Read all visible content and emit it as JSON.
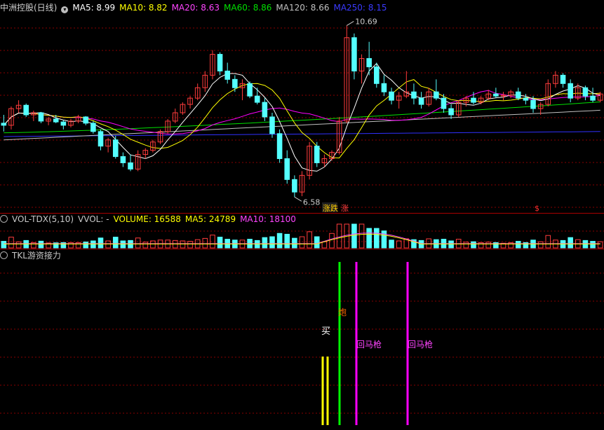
{
  "main_header": {
    "stock_name": "中洲控股(日线)",
    "ma5": "MA5: 8.99",
    "ma10": "MA10: 8.82",
    "ma20": "MA20: 8.63",
    "ma60": "MA60: 8.86",
    "ma120": "MA120: 8.66",
    "ma250": "MA250: 8.15"
  },
  "vol_header": {
    "name": "VOL-TDX(5,10)",
    "vvol": "VVOL: -",
    "volume": "VOLUME: 16588",
    "ma5": "MA5: 24789",
    "ma10": "MA10: 18100"
  },
  "indicator_header": {
    "name": "TKL游资接力"
  },
  "colors": {
    "up": "#ff3c3c",
    "down": "#54ffff",
    "ma5": "#ffffff",
    "ma10": "#ffff00",
    "ma20": "#ff00ff",
    "ma60": "#00e000",
    "ma120": "#c0c0c0",
    "ma250": "#3030ff",
    "grid": "#8a0000",
    "divider": "#aa0000"
  },
  "chart_data": [
    {
      "type": "candlestick",
      "panel": "price",
      "price_range": [
        6.2,
        11.0
      ],
      "annotations": {
        "high_label": "10.69",
        "low_label": "6.58",
        "signal_tags": [
          "涨跌",
          "涨",
          "$"
        ]
      },
      "candles": [
        [
          8.35,
          8.55,
          8.15,
          8.3
        ],
        [
          8.3,
          8.75,
          8.2,
          8.7
        ],
        [
          8.7,
          8.9,
          8.6,
          8.78
        ],
        [
          8.78,
          8.82,
          8.5,
          8.55
        ],
        [
          8.55,
          8.65,
          8.4,
          8.6
        ],
        [
          8.6,
          8.62,
          8.35,
          8.4
        ],
        [
          8.4,
          8.5,
          8.3,
          8.45
        ],
        [
          8.45,
          8.55,
          8.35,
          8.38
        ],
        [
          8.38,
          8.42,
          8.2,
          8.3
        ],
        [
          8.3,
          8.45,
          8.25,
          8.4
        ],
        [
          8.4,
          8.55,
          8.35,
          8.5
        ],
        [
          8.5,
          8.52,
          8.3,
          8.35
        ],
        [
          8.35,
          8.4,
          8.1,
          8.15
        ],
        [
          8.15,
          8.2,
          7.7,
          7.8
        ],
        [
          7.8,
          8.0,
          7.65,
          7.95
        ],
        [
          7.95,
          8.05,
          7.5,
          7.55
        ],
        [
          7.55,
          7.65,
          7.3,
          7.4
        ],
        [
          7.4,
          7.6,
          7.2,
          7.25
        ],
        [
          7.25,
          7.7,
          7.2,
          7.6
        ],
        [
          7.6,
          7.75,
          7.5,
          7.7
        ],
        [
          7.7,
          7.95,
          7.65,
          7.9
        ],
        [
          7.9,
          8.2,
          7.85,
          8.15
        ],
        [
          8.15,
          8.45,
          8.1,
          8.4
        ],
        [
          8.4,
          8.7,
          8.35,
          8.6
        ],
        [
          8.6,
          8.85,
          8.55,
          8.8
        ],
        [
          8.8,
          9.0,
          8.7,
          8.95
        ],
        [
          8.95,
          9.3,
          8.9,
          9.2
        ],
        [
          9.2,
          9.6,
          9.1,
          9.5
        ],
        [
          9.5,
          10.1,
          9.4,
          10.0
        ],
        [
          10.0,
          10.05,
          9.5,
          9.6
        ],
        [
          9.6,
          9.8,
          9.3,
          9.4
        ],
        [
          9.4,
          9.5,
          9.1,
          9.2
        ],
        [
          9.2,
          9.4,
          8.9,
          9.3
        ],
        [
          9.3,
          9.35,
          8.95,
          9.0
        ],
        [
          9.0,
          9.2,
          8.8,
          8.85
        ],
        [
          8.85,
          8.95,
          8.4,
          8.5
        ],
        [
          8.5,
          8.6,
          8.0,
          8.1
        ],
        [
          8.1,
          8.2,
          7.4,
          7.5
        ],
        [
          7.5,
          7.7,
          6.9,
          7.0
        ],
        [
          7.0,
          7.1,
          6.58,
          6.7
        ],
        [
          6.7,
          7.2,
          6.6,
          7.1
        ],
        [
          7.1,
          7.9,
          7.0,
          7.8
        ],
        [
          7.8,
          7.9,
          7.3,
          7.4
        ],
        [
          7.4,
          7.6,
          7.3,
          7.5
        ],
        [
          7.5,
          7.7,
          7.45,
          7.65
        ],
        [
          7.65,
          8.5,
          7.6,
          8.4
        ],
        [
          8.4,
          10.69,
          8.35,
          10.4
        ],
        [
          10.4,
          10.5,
          9.4,
          9.6
        ],
        [
          9.6,
          10.0,
          9.3,
          9.9
        ],
        [
          9.9,
          10.3,
          9.5,
          9.7
        ],
        [
          9.7,
          9.8,
          9.2,
          9.3
        ],
        [
          9.3,
          9.5,
          9.0,
          9.1
        ],
        [
          9.1,
          9.2,
          8.8,
          8.9
        ],
        [
          8.9,
          9.1,
          8.7,
          9.0
        ],
        [
          9.0,
          9.6,
          8.95,
          9.1
        ],
        [
          9.1,
          9.3,
          8.8,
          8.95
        ],
        [
          8.95,
          9.1,
          8.7,
          8.8
        ],
        [
          8.8,
          9.2,
          8.75,
          9.1
        ],
        [
          9.1,
          9.4,
          8.9,
          8.95
        ],
        [
          8.95,
          9.05,
          8.6,
          8.7
        ],
        [
          8.7,
          8.8,
          8.45,
          8.55
        ],
        [
          8.55,
          8.9,
          8.5,
          8.85
        ],
        [
          8.85,
          9.0,
          8.75,
          8.95
        ],
        [
          8.95,
          9.1,
          8.8,
          8.85
        ],
        [
          8.85,
          9.0,
          8.8,
          8.95
        ],
        [
          8.95,
          9.15,
          8.9,
          9.05
        ],
        [
          9.05,
          9.2,
          8.95,
          9.0
        ],
        [
          9.0,
          9.1,
          8.9,
          9.02
        ],
        [
          9.02,
          9.15,
          8.95,
          9.1
        ],
        [
          9.1,
          9.2,
          8.9,
          8.95
        ],
        [
          8.95,
          9.05,
          8.8,
          8.9
        ],
        [
          8.9,
          9.0,
          8.6,
          8.7
        ],
        [
          8.7,
          8.85,
          8.55,
          8.8
        ],
        [
          8.8,
          9.4,
          8.75,
          9.3
        ],
        [
          9.3,
          9.6,
          9.2,
          9.5
        ],
        [
          9.5,
          9.55,
          9.2,
          9.3
        ],
        [
          9.3,
          9.4,
          8.85,
          8.95
        ],
        [
          8.95,
          9.3,
          8.9,
          9.2
        ],
        [
          9.2,
          9.25,
          8.9,
          9.0
        ],
        [
          9.0,
          9.2,
          8.85,
          8.9
        ],
        [
          8.9,
          9.1,
          8.85,
          9.05
        ]
      ]
    },
    {
      "type": "bar",
      "panel": "volume",
      "ma5_value": 24789,
      "ma10_value": 18100,
      "volume_value": 16588
    },
    {
      "type": "signal-bars",
      "panel": "indicator",
      "signals": [
        {
          "label": "买",
          "color": "#ffff00",
          "level": 0.42
        },
        {
          "label": "",
          "color": "#ffff00",
          "level": 0.42
        },
        {
          "label": "炮",
          "color": "#00ff00",
          "level": 1.0
        },
        {
          "label": "回马枪",
          "color": "#ff00ff",
          "level": 1.0
        },
        {
          "label": "回马枪",
          "color": "#ff00ff",
          "level": 1.0
        }
      ]
    }
  ]
}
